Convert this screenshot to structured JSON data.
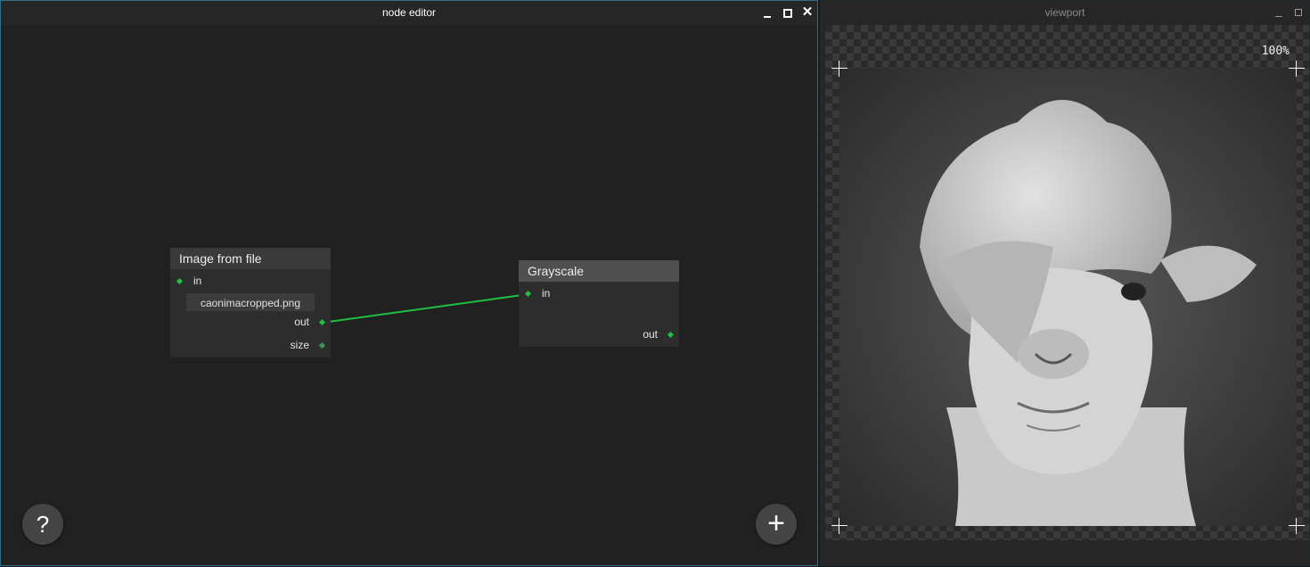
{
  "node_editor": {
    "title": "node editor",
    "help_label": "?",
    "add_label": "+",
    "nodes": {
      "image_from_file": {
        "title": "Image from file",
        "port_in": "in",
        "filename": "caonimacropped.png",
        "port_out": "out",
        "port_size": "size"
      },
      "grayscale": {
        "title": "Grayscale",
        "port_in": "in",
        "port_out": "out"
      }
    },
    "connection_color": "#21c040"
  },
  "viewport": {
    "title": "viewport",
    "zoom": "100%",
    "image_description_icon": "grayscale-alpaca-image"
  },
  "colors": {
    "accent_border": "#2d6e8a",
    "port_green": "#21c040"
  }
}
